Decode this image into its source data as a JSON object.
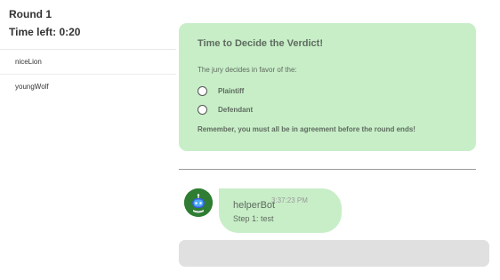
{
  "game": {
    "round_label": "Round 1",
    "time_left_label": "Time left: 0:20"
  },
  "players": [
    {
      "name": "niceLion"
    },
    {
      "name": "youngWolf"
    }
  ],
  "verdict": {
    "title": "Time to Decide the Verdict!",
    "prompt": "The jury decides in favor of the:",
    "options": [
      {
        "label": "Plaintiff",
        "selected": false
      },
      {
        "label": "Defendant",
        "selected": false
      }
    ],
    "reminder": "Remember, you must all be in agreement before the round ends!"
  },
  "chat": {
    "messages": [
      {
        "sender": "helperBot",
        "time": "3:37:23 PM",
        "text": "Step 1: test",
        "avatar_icon": "robot-icon"
      }
    ],
    "input": {
      "value": "",
      "placeholder": ""
    }
  },
  "colors": {
    "card_bg": "#c8eec8",
    "avatar_bg": "#2e7d32",
    "input_bg": "#e0e0e0"
  }
}
